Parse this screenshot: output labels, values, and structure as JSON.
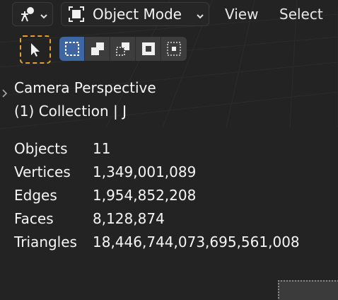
{
  "header": {
    "editor_type_icon": "person-pose-icon",
    "mode_label": "Object Mode",
    "menu": {
      "view": "View",
      "select": "Select"
    }
  },
  "toolbar": {
    "select_tool_icon": "cursor-arrow-icon",
    "select_modes": [
      {
        "name": "select-new",
        "active": true
      },
      {
        "name": "select-extend",
        "active": false
      },
      {
        "name": "select-subtract",
        "active": false
      },
      {
        "name": "select-invert",
        "active": false
      },
      {
        "name": "select-intersect",
        "active": false
      }
    ]
  },
  "overlay": {
    "camera": "Camera Perspective",
    "collection": "(1) Collection | J"
  },
  "stats": [
    {
      "label": "Objects",
      "value": "11"
    },
    {
      "label": "Vertices",
      "value": "1,349,001,089"
    },
    {
      "label": "Edges",
      "value": "1,954,852,208"
    },
    {
      "label": "Faces",
      "value": "8,128,874"
    },
    {
      "label": "Triangles",
      "value": "18,446,744,073,695,561,008"
    }
  ],
  "colors": {
    "background": "#232323",
    "active_tool_outline": "#e4a02f",
    "active_mode": "#3e66a3"
  }
}
